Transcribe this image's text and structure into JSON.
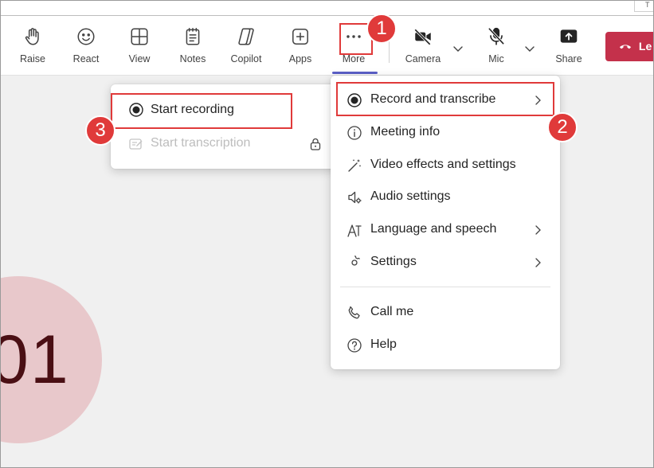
{
  "toolbar": {
    "topchip": "T",
    "buttons": [
      {
        "label": "Raise",
        "icon": "raise-hand-icon"
      },
      {
        "label": "React",
        "icon": "react-icon"
      },
      {
        "label": "View",
        "icon": "view-icon"
      },
      {
        "label": "Notes",
        "icon": "notes-icon"
      },
      {
        "label": "Copilot",
        "icon": "copilot-icon"
      },
      {
        "label": "Apps",
        "icon": "apps-icon"
      },
      {
        "label": "More",
        "icon": "more-icon"
      },
      {
        "label": "Camera",
        "icon": "camera-off-icon"
      },
      {
        "label": "Mic",
        "icon": "mic-off-icon"
      },
      {
        "label": "Share",
        "icon": "share-icon"
      }
    ],
    "leave_label": "Le"
  },
  "more_menu": {
    "items": [
      {
        "label": "Record and transcribe",
        "icon": "record-icon",
        "has_submenu": true
      },
      {
        "label": "Meeting info",
        "icon": "info-icon",
        "has_submenu": false
      },
      {
        "label": "Video effects and settings",
        "icon": "video-effects-icon",
        "has_submenu": false
      },
      {
        "label": "Audio settings",
        "icon": "audio-settings-icon",
        "has_submenu": false
      },
      {
        "label": "Language and speech",
        "icon": "language-icon",
        "has_submenu": true
      },
      {
        "label": "Settings",
        "icon": "gear-icon",
        "has_submenu": true
      },
      {
        "label": "Call me",
        "icon": "phone-icon",
        "has_submenu": false
      },
      {
        "label": "Help",
        "icon": "help-icon",
        "has_submenu": false
      }
    ]
  },
  "record_submenu": {
    "items": [
      {
        "label": "Start recording",
        "icon": "record-icon",
        "enabled": true
      },
      {
        "label": "Start transcription",
        "icon": "transcription-icon",
        "enabled": false
      }
    ]
  },
  "callouts": [
    "1",
    "2",
    "3"
  ],
  "avatar": {
    "initials": "01",
    "color": "#e8c8cb"
  },
  "colors": {
    "accent": "#5b5fc7",
    "leave_button": "#c4314b",
    "callout_red": "#e03a3a"
  }
}
